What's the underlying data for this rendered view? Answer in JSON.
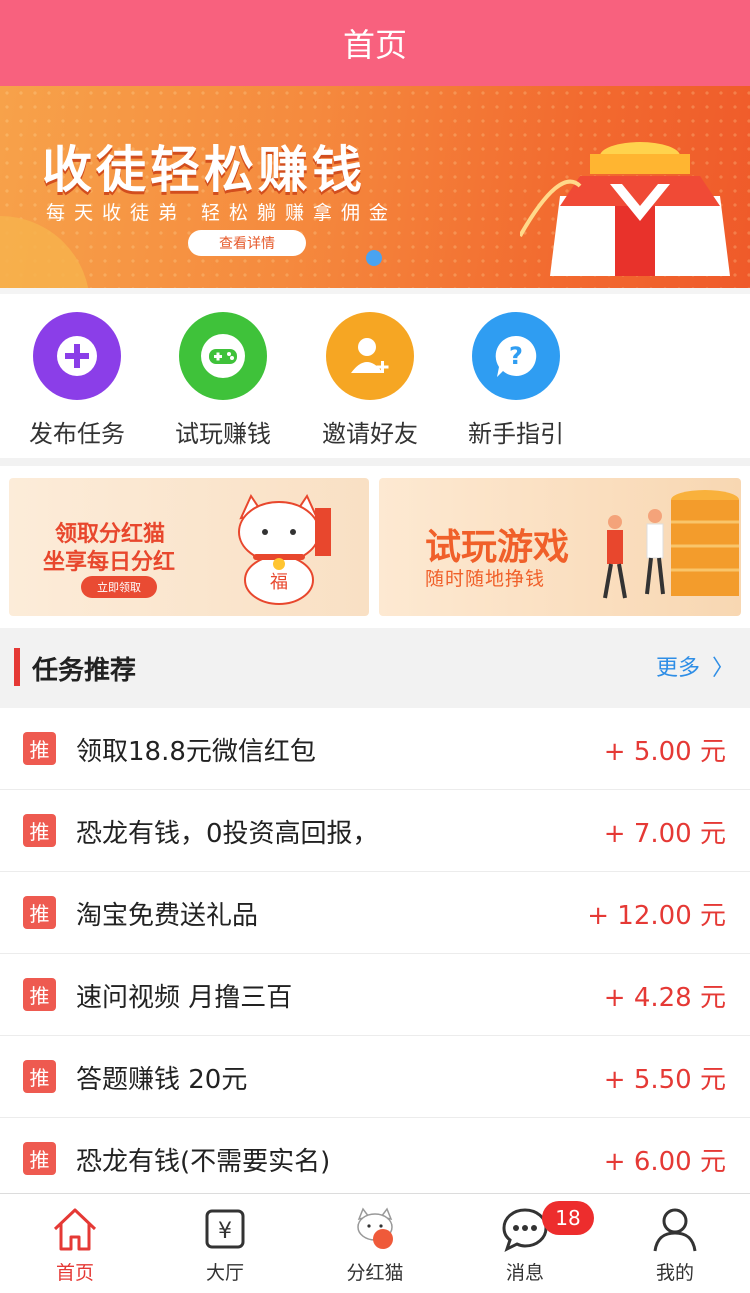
{
  "header": {
    "title": "首页"
  },
  "banner": {
    "title": "收徒轻松赚钱",
    "subtitle": "每天收徒弟 轻松躺赚拿佣金",
    "button": "查看详情"
  },
  "quick_actions": [
    {
      "label": "发布任务",
      "icon": "plus-circle-icon",
      "color": "#8b3ee8"
    },
    {
      "label": "试玩赚钱",
      "icon": "gamepad-icon",
      "color": "#3fc23a"
    },
    {
      "label": "邀请好友",
      "icon": "add-user-icon",
      "color": "#f6a623"
    },
    {
      "label": "新手指引",
      "icon": "help-bubble-icon",
      "color": "#2f9df2"
    }
  ],
  "promos": {
    "left": {
      "line1": "领取分红猫",
      "line2": "坐享每日分红",
      "button": "立即领取"
    },
    "right": {
      "line1": "试玩游戏",
      "line2": "随时随地挣钱"
    }
  },
  "section": {
    "title": "任务推荐",
    "more": "更多",
    "more_icon": "chevron-right-icon"
  },
  "tasks": [
    {
      "badge": "推",
      "title": "领取18.8元微信红包",
      "reward": "+ 5.00 元"
    },
    {
      "badge": "推",
      "title": "恐龙有钱，0投资高回报，",
      "reward": "+ 7.00 元"
    },
    {
      "badge": "推",
      "title": "淘宝免费送礼品",
      "reward": "+ 12.00 元"
    },
    {
      "badge": "推",
      "title": "速问视频 月撸三百",
      "reward": "+ 4.28 元"
    },
    {
      "badge": "推",
      "title": "答题赚钱 20元",
      "reward": "+ 5.50 元"
    },
    {
      "badge": "推",
      "title": "恐龙有钱(不需要实名)",
      "reward": "+ 6.00 元"
    }
  ],
  "tabbar": [
    {
      "label": "首页",
      "icon": "home-icon",
      "active": true
    },
    {
      "label": "大厅",
      "icon": "yuan-card-icon"
    },
    {
      "label": "分红猫",
      "icon": "lucky-cat-icon"
    },
    {
      "label": "消息",
      "icon": "chat-bubble-icon",
      "badge": "18"
    },
    {
      "label": "我的",
      "icon": "person-icon"
    }
  ],
  "colors": {
    "primary": "#f8617e",
    "accent_red": "#e53935",
    "link_blue": "#2f8ee6"
  }
}
